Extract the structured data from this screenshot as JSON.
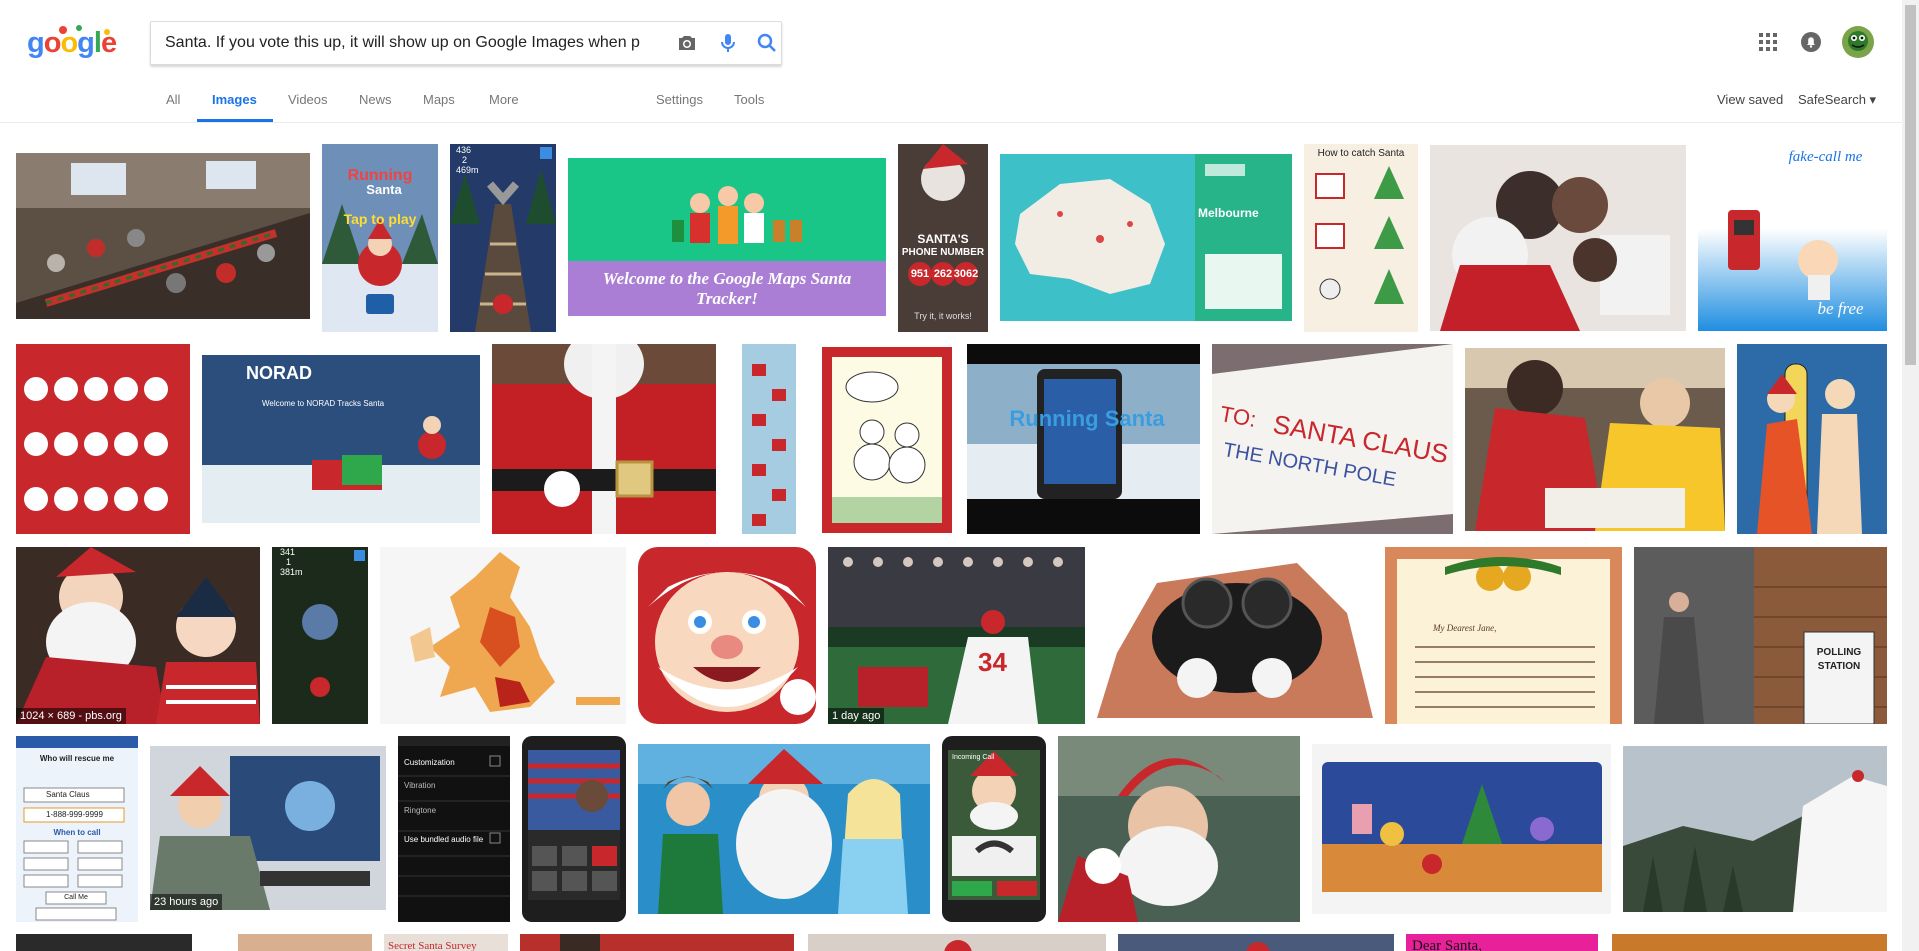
{
  "logo": {
    "text": "google"
  },
  "search": {
    "query": "Santa. If you vote this up, it will show up on Google Images when p"
  },
  "tabs": [
    {
      "label": "All"
    },
    {
      "label": "Images"
    },
    {
      "label": "Videos"
    },
    {
      "label": "News"
    },
    {
      "label": "Maps"
    },
    {
      "label": "More"
    }
  ],
  "tools": {
    "settings": "Settings",
    "tools": "Tools"
  },
  "right_links": {
    "view_saved": "View saved",
    "safesearch": "SafeSearch ▾"
  },
  "thumbs": {
    "t3": {
      "score": "436",
      "stars": "2",
      "dist": "469m"
    },
    "t4": {
      "caption": "Welcome to the Google Maps Santa Tracker!"
    },
    "t5": {
      "l1": "SANTA'S",
      "l2": "PHONE NUMBER",
      "n1": "951",
      "n2": "262",
      "n3": "3062",
      "foot": "Try it, it works!"
    },
    "t6": {
      "city": "Melbourne"
    },
    "t7": {
      "title": "How to catch Santa"
    },
    "t8": {
      "l1": "fake-call me",
      "l2": "be free"
    },
    "t11": {
      "brand": "NORAD",
      "sub": "Welcome to NORAD Tracks Santa"
    },
    "t15": {
      "text": "Running Santa"
    },
    "t16": {
      "l1": "TO:",
      "l2": "SANTA CLAUS",
      "l3": "THE NORTH POLE"
    },
    "t19": {
      "meta": "1024 × 689 - pbs.org"
    },
    "t20": {
      "score": "341",
      "stars": "1",
      "dist": "381m"
    },
    "t23": {
      "meta": "1 day ago",
      "jersey": "34"
    },
    "t25": {
      "l1": "My Dearest Jane,"
    },
    "t26": {
      "l1": "POLLING",
      "l2": "STATION"
    },
    "t27": {
      "title": "Who will rescue me",
      "caller": "Santa Claus",
      "number": "1-888-999-9999",
      "b1": "When to call",
      "btn": "Call Me"
    },
    "t28": {
      "meta": "23 hours ago"
    },
    "t29": {
      "l1": "Customization",
      "l2": "Vibration",
      "l3": "Ringtone",
      "l4": "Use bundled audio file"
    },
    "t32": {
      "l1": "Incoming Call"
    },
    "t36": {
      "l1": "Secret Santa Survey"
    },
    "t37": {
      "l1": "Dear Santa,"
    }
  },
  "colors": {
    "accent": "#1a73e8",
    "link_gray": "#777777"
  }
}
